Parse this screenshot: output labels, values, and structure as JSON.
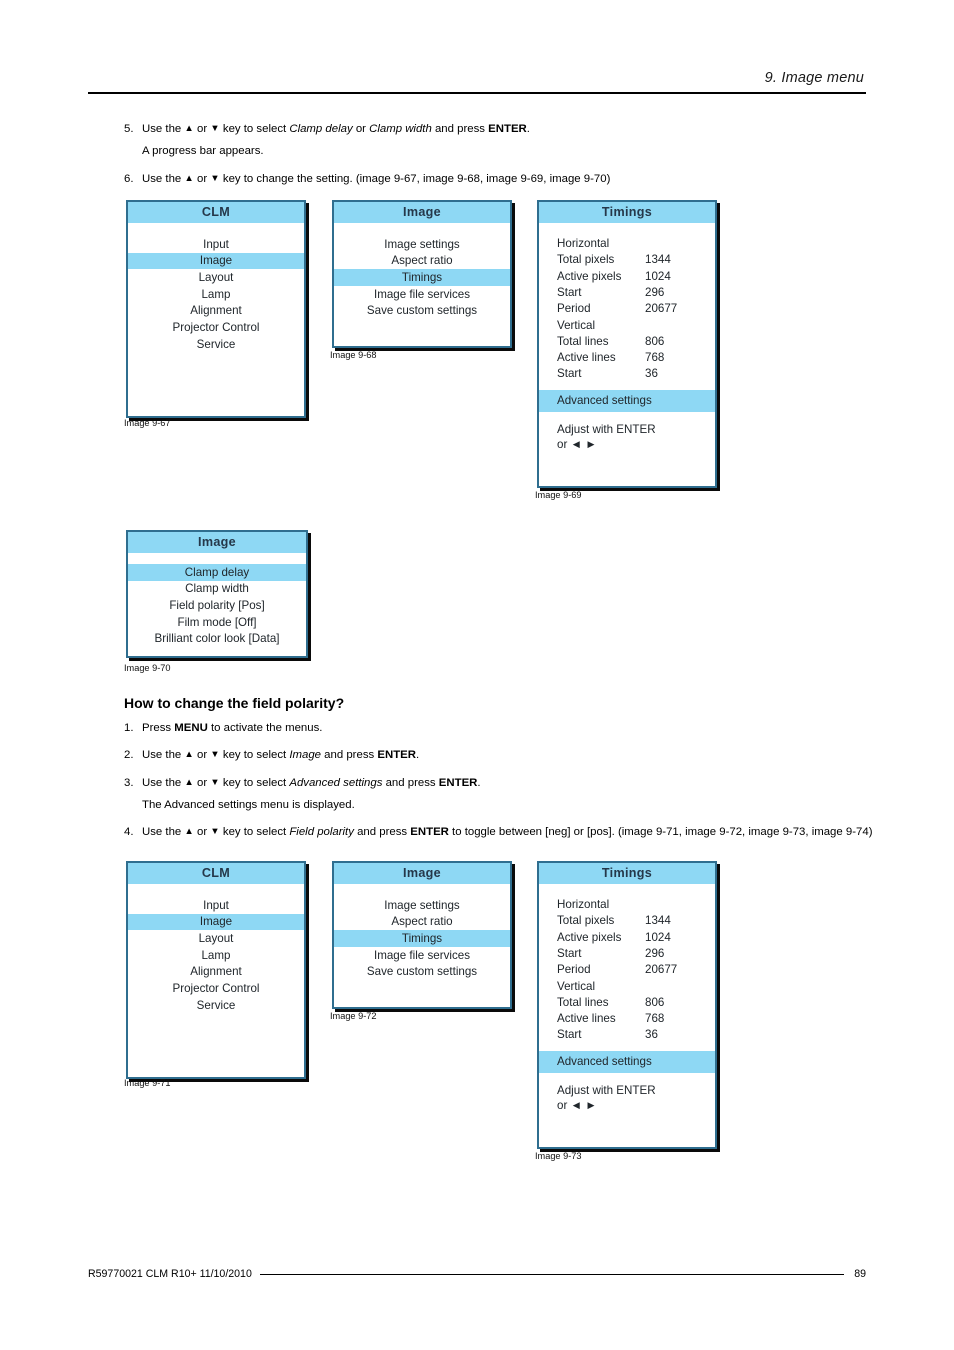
{
  "header": {
    "title": "9.  Image menu"
  },
  "steps_top": [
    {
      "num": "5.",
      "parts": [
        {
          "t": "Use the ",
          "s": "plain"
        },
        {
          "t": "▲",
          "s": "arrow"
        },
        {
          "t": " or ",
          "s": "plain"
        },
        {
          "t": "▼",
          "s": "arrow"
        },
        {
          "t": " key to select ",
          "s": "plain"
        },
        {
          "t": "Clamp delay",
          "s": "ital"
        },
        {
          "t": " or ",
          "s": "plain"
        },
        {
          "t": "Clamp width",
          "s": "ital"
        },
        {
          "t": " and press ",
          "s": "plain"
        },
        {
          "t": "ENTER",
          "s": "bold"
        },
        {
          "t": ".",
          "s": "plain"
        }
      ]
    }
  ],
  "note_progress": "A progress bar appears.",
  "step6": {
    "num": "6.",
    "parts": [
      {
        "t": "Use the ",
        "s": "plain"
      },
      {
        "t": "▲",
        "s": "arrow"
      },
      {
        "t": " or ",
        "s": "plain"
      },
      {
        "t": "▼",
        "s": "arrow"
      },
      {
        "t": " key to change the setting.  (image 9-67, image 9-68, image 9-69, image 9-70)",
        "s": "plain"
      }
    ]
  },
  "section": {
    "title": "How to change the field polarity?",
    "steps": [
      {
        "num": "1.",
        "parts": [
          {
            "t": "Press ",
            "s": "plain"
          },
          {
            "t": "MENU",
            "s": "bold"
          },
          {
            "t": " to activate the menus.",
            "s": "plain"
          }
        ]
      },
      {
        "num": "2.",
        "parts": [
          {
            "t": "Use the ",
            "s": "plain"
          },
          {
            "t": "▲",
            "s": "arrow"
          },
          {
            "t": " or ",
            "s": "plain"
          },
          {
            "t": "▼",
            "s": "arrow"
          },
          {
            "t": " key to select ",
            "s": "plain"
          },
          {
            "t": "Image",
            "s": "ital"
          },
          {
            "t": " and press ",
            "s": "plain"
          },
          {
            "t": "ENTER",
            "s": "bold"
          },
          {
            "t": ".",
            "s": "plain"
          }
        ]
      },
      {
        "num": "3.",
        "parts": [
          {
            "t": "Use the ",
            "s": "plain"
          },
          {
            "t": "▲",
            "s": "arrow"
          },
          {
            "t": " or ",
            "s": "plain"
          },
          {
            "t": "▼",
            "s": "arrow"
          },
          {
            "t": " key to select ",
            "s": "plain"
          },
          {
            "t": "Advanced settings",
            "s": "ital"
          },
          {
            "t": " and press ",
            "s": "plain"
          },
          {
            "t": "ENTER",
            "s": "bold"
          },
          {
            "t": ".",
            "s": "plain"
          }
        ]
      }
    ],
    "note_advanced": "The Advanced settings menu is displayed.",
    "step4": {
      "num": "4.",
      "parts": [
        {
          "t": "Use the ",
          "s": "plain"
        },
        {
          "t": "▲",
          "s": "arrow"
        },
        {
          "t": " or ",
          "s": "plain"
        },
        {
          "t": "▼",
          "s": "arrow"
        },
        {
          "t": " key to select ",
          "s": "plain"
        },
        {
          "t": "Field polarity",
          "s": "ital"
        },
        {
          "t": " and press ",
          "s": "plain"
        },
        {
          "t": "ENTER",
          "s": "bold"
        },
        {
          "t": " to toggle between [neg] or [pos].  (image 9-71, image 9-72, image 9-73, image 9-74)",
          "s": "plain"
        }
      ]
    }
  },
  "osd": {
    "clm": {
      "title": "CLM",
      "items": [
        {
          "label": "Input",
          "selected": false
        },
        {
          "label": "Image",
          "selected": true
        },
        {
          "label": "Layout",
          "selected": false
        },
        {
          "label": "Lamp",
          "selected": false
        },
        {
          "label": "Alignment",
          "selected": false
        },
        {
          "label": "Projector Control",
          "selected": false
        },
        {
          "label": "Service",
          "selected": false
        }
      ]
    },
    "image_menu": {
      "title": "Image",
      "items": [
        {
          "label": "Image settings",
          "selected": false
        },
        {
          "label": "Aspect ratio",
          "selected": false
        },
        {
          "label": "Timings",
          "selected": true
        },
        {
          "label": "Image file services",
          "selected": false
        },
        {
          "label": "Save custom settings",
          "selected": false
        }
      ]
    },
    "timings": {
      "title": "Timings",
      "rows": [
        {
          "label": "Horizontal",
          "value": ""
        },
        {
          "label": "Total pixels",
          "value": "1344"
        },
        {
          "label": "Active pixels",
          "value": "1024"
        },
        {
          "label": "Start",
          "value": "296"
        },
        {
          "label": "Period",
          "value": "20677"
        },
        {
          "label": "Vertical",
          "value": ""
        },
        {
          "label": "Total lines",
          "value": "806"
        },
        {
          "label": "Active lines",
          "value": "768"
        },
        {
          "label": "Start",
          "value": "36"
        }
      ],
      "highlight": "Advanced settings",
      "footer_line1": "Adjust with ENTER",
      "footer_line2": "or ◄ ►"
    },
    "image_advanced": {
      "title": "Image",
      "items": [
        {
          "label": "Clamp delay",
          "selected": true
        },
        {
          "label": "Clamp width",
          "selected": false
        },
        {
          "label": "Field polarity [Pos]",
          "selected": false
        },
        {
          "label": "Film mode [Off]",
          "selected": false
        },
        {
          "label": "Brilliant color look [Data]",
          "selected": false
        }
      ]
    }
  },
  "captions": {
    "c9_67": "Image 9-67",
    "c9_68": "Image 9-68",
    "c9_69": "Image 9-69",
    "c9_70": "Image 9-70",
    "c9_71": "Image 9-71",
    "c9_72": "Image 9-72",
    "c9_73": "Image 9-73"
  },
  "footer": {
    "left": "R59770021  CLM R10+  11/10/2010",
    "page": "89"
  },
  "colors": {
    "osd_highlight": "#8ed8f4",
    "osd_border": "#2f6e8f",
    "osd_shadow": "#0a0a0a",
    "text": "#000000"
  }
}
